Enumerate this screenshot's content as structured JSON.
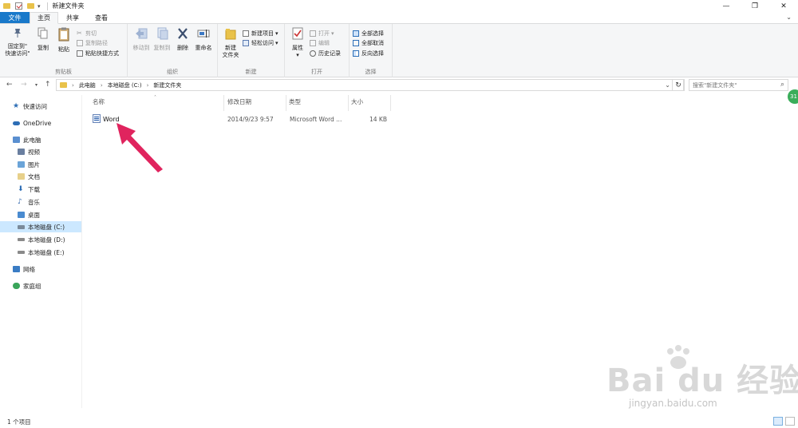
{
  "window": {
    "title": "新建文件夹",
    "minimize": "—",
    "maximize": "❐",
    "close": "✕"
  },
  "tabs": [
    {
      "label": "文件"
    },
    {
      "label": "主页"
    },
    {
      "label": "共享"
    },
    {
      "label": "查看"
    }
  ],
  "ribbon": {
    "clipboard": {
      "pin_label_1": "固定到\"",
      "pin_label_2": "快速访问\"",
      "copy": "复制",
      "paste": "粘贴",
      "cut": "剪切",
      "copy_path": "复制路径",
      "paste_shortcut": "粘贴快捷方式",
      "group": "剪贴板"
    },
    "organize": {
      "move_to": "移动到",
      "copy_to": "复制到",
      "delete": "删除",
      "rename": "重命名",
      "group": "组织"
    },
    "new": {
      "new_folder_1": "新建",
      "new_folder_2": "文件夹",
      "new_item": "新建项目",
      "easy_access": "轻松访问",
      "group": "新建"
    },
    "open": {
      "properties": "属性",
      "open": "打开",
      "edit": "编辑",
      "history": "历史记录",
      "group": "打开"
    },
    "select": {
      "select_all": "全部选择",
      "select_none": "全部取消",
      "invert": "反向选择",
      "group": "选择"
    }
  },
  "address": {
    "crumbs": [
      "此电脑",
      "本地磁盘 (C:)",
      "新建文件夹"
    ],
    "search_placeholder": "搜索\"新建文件夹\""
  },
  "nav": {
    "quick_access": "快速访问",
    "onedrive": "OneDrive",
    "this_pc": "此电脑",
    "videos": "视频",
    "pictures": "图片",
    "documents": "文档",
    "downloads": "下载",
    "music": "音乐",
    "desktop": "桌面",
    "drive_c": "本地磁盘 (C:)",
    "drive_d": "本地磁盘 (D:)",
    "drive_e": "本地磁盘 (E:)",
    "network": "网络",
    "homegroup": "家庭组"
  },
  "columns": {
    "name": "名称",
    "modified": "修改日期",
    "type": "类型",
    "size": "大小"
  },
  "files": [
    {
      "name": "Word",
      "modified": "2014/9/23 9:57",
      "type": "Microsoft Word ...",
      "size": "14 KB"
    }
  ],
  "status": {
    "count": "1 个项目"
  },
  "badge": "31",
  "watermark": {
    "main": "Bai du 经验",
    "sub": "jingyan.baidu.com"
  },
  "colors": {
    "file_tab": "#1979ca",
    "selected_nav": "#cce8ff",
    "annotation_arrow": "#e0245e",
    "folder": "#e9c24a"
  }
}
